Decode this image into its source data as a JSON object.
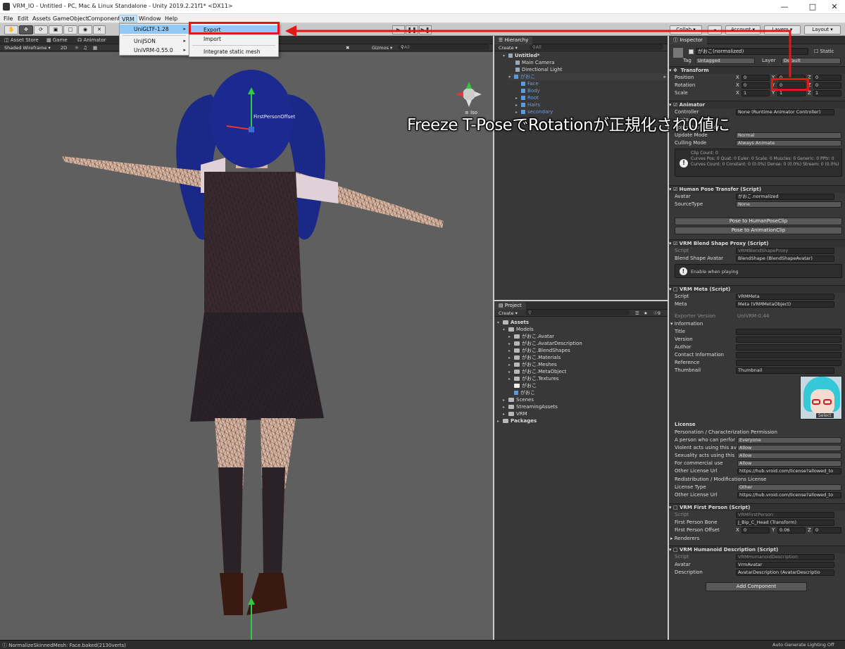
{
  "window": {
    "title": "VRM_IO - Untitled - PC, Mac & Linux Standalone - Unity 2019.2.21f1* <DX11>"
  },
  "menu": [
    "File",
    "Edit",
    "Assets",
    "GameObject",
    "Component",
    "VRM",
    "Window",
    "Help"
  ],
  "vrm_menu": {
    "items": [
      "UniGLTF-1.28",
      "UniJSON",
      "UniVRM-0.55.0"
    ]
  },
  "unigltf_submenu": {
    "items": [
      "Export",
      "Import",
      "Integrate static mesh"
    ]
  },
  "toolbar": {
    "collab": "Collab",
    "account": "Account",
    "layers": "Layers",
    "layout": "Layout"
  },
  "left_tabs": [
    "Asset Store",
    "Game",
    "Animator"
  ],
  "scene_bar": {
    "shading": "Shaded Wireframe",
    "mode2d": "2D",
    "gizmos": "Gizmos",
    "search": "All",
    "iso": "Iso"
  },
  "scene_label": "FirstPersonOffset",
  "hierarchy": {
    "title": "Hierarchy",
    "create": "Create",
    "search": "All",
    "rows": [
      "Untitled*",
      "Main Camera",
      "Directional Light",
      "がおこ",
      "Face",
      "Body",
      "Root",
      "Hairs",
      "secondary"
    ]
  },
  "project": {
    "title": "Project",
    "create": "Create",
    "count": "9",
    "rows": [
      "Assets",
      "Models",
      "がおこ.Avatar",
      "がおこ.AvatarDescription",
      "がおこ.BlendShapes",
      "がおこ.Materials",
      "がおこ.Meshes",
      "がおこ.MetaObject",
      "がおこ.Textures",
      "がおこ",
      "がおこ",
      "Scenes",
      "StreamingAssets",
      "VRM",
      "Packages"
    ]
  },
  "inspector": {
    "title": "Inspector",
    "object_name": "がおこ(normalized)",
    "static_label": "Static",
    "tag_label": "Tag",
    "tag_value": "Untagged",
    "layer_label": "Layer",
    "layer_value": "Default",
    "transform": {
      "title": "Transform",
      "position": "Position",
      "rotation": "Rotation",
      "scale": "Scale",
      "x": "X",
      "y": "Y",
      "z": "Z",
      "pos": [
        "0",
        "0",
        "0"
      ],
      "rot": [
        "0",
        "0",
        "0"
      ],
      "scl": [
        "1",
        "1",
        "1"
      ]
    },
    "animator": {
      "title": "Animator",
      "controller_label": "Controller",
      "controller_value": "None (Runtime Animator Controller)",
      "avatar_label": "Avatar",
      "root_motion": "Apply Root Motion",
      "update_mode_label": "Update Mode",
      "update_mode_value": "Normal",
      "culling_label": "Culling Mode",
      "culling_value": "Always Animate",
      "info": [
        "Clip Count: 0",
        "Curves Pos: 0 Quat: 0 Euler: 0 Scale: 0 Muscles: 0 Generic: 0 PPtr: 0",
        "Curves Count: 0 Constant: 0 (0.0%) Dense: 0 (0.0%) Stream: 0 (0.0%)"
      ]
    },
    "hpt": {
      "title": "Human Pose Transfer (Script)",
      "avatar_label": "Avatar",
      "avatar_value": "がおこ.normalized",
      "source_label": "SourceType",
      "source_value": "None",
      "btn1": "Pose to HumanPoseClip",
      "btn2": "Pose to AnimationClip"
    },
    "blend": {
      "title": "VRM Blend Shape Proxy (Script)",
      "script_label": "Script",
      "script_value": "VRMBlendShapeProxy",
      "avatar_label": "Blend Shape Avatar",
      "avatar_value": "BlendShape (BlendShapeAvatar)",
      "help": "Enable when playing"
    },
    "meta": {
      "title": "VRM Meta (Script)",
      "script_label": "Script",
      "script_value": "VRMMeta",
      "meta_label": "Meta",
      "meta_value": "Meta (VRMMetaObject)",
      "exporter_label": "Exporter Version",
      "exporter_value": "UniVRM-0.44",
      "information": "Information",
      "fields": [
        "Title",
        "Version",
        "Author",
        "Contact Information",
        "Reference"
      ],
      "thumb_label": "Thumbnail",
      "thumb_value": "Thumbnail",
      "select": "Select",
      "license": "License",
      "perm_header": "Personation / Characterization Permission",
      "perm_rows": [
        {
          "label": "A person who can perfor",
          "value": "Everyone"
        },
        {
          "label": "Violent acts using this av",
          "value": "Allow"
        },
        {
          "label": "Sexuality acts using this",
          "value": "Allow"
        },
        {
          "label": "For commercial use",
          "value": "Allow"
        },
        {
          "label": "Other License Url",
          "value": "https://hub.vroid.com/license?allowed_to"
        }
      ],
      "redis_header": "Redistribution / Modifications License",
      "lic_type_label": "License Type",
      "lic_type_value": "Other",
      "other_lic_label": "Other License Url",
      "other_lic_value": "https://hub.vroid.com/license?allowed_to"
    },
    "fp": {
      "title": "VRM First Person (Script)",
      "script_label": "Script",
      "script_value": "VRMFirstPerson",
      "bone_label": "First Person Bone",
      "bone_value": "J_Bip_C_Head (Transform)",
      "offset_label": "First Person Offset",
      "ox": "0",
      "oy": "0.06",
      "oz": "0",
      "renderers": "Renderers"
    },
    "hum": {
      "title": "VRM Humanoid Description (Script)",
      "script_label": "Script",
      "script_value": "VRMHumanoidDescription",
      "avatar_label": "Avatar",
      "avatar_value": "VrmAvatar",
      "desc_label": "Description",
      "desc_value": "AvatarDescription (AvatarDescriptio"
    },
    "add_component": "Add Component"
  },
  "annotation": "Freeze T-PoseでRotationが正規化され0値に",
  "status": {
    "left": "NormalizeSkinnedMesh: Face.baked(2130verts)",
    "right": "Auto Generate Lighting Off"
  },
  "colors": {
    "highlight_red": "#e01818",
    "menu_selected": "#91c9f7"
  }
}
